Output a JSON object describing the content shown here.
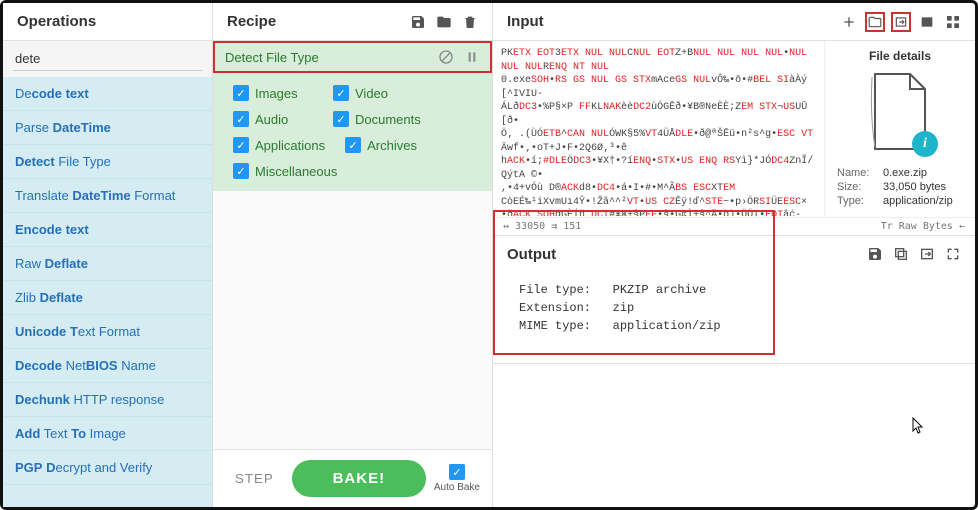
{
  "operations": {
    "title": "Operations",
    "search_value": "dete",
    "items": [
      "De<b>code</b> <b>text</b>",
      "Parse <b>DateTime</b>",
      "<b>Detect</b> File Type",
      "Translate <b>DateTime</b> Format",
      "<b>Encode</b> <b>text</b>",
      "Raw <b>Deflate</b>",
      "Zlib <b>Deflate</b>",
      "<b>Unicode</b> <b>T</b>ext Format",
      "<b>Decode</b> Net<b>BIOS</b> Name",
      "<b>Dechunk</b> HTTP response",
      "<b>Add</b> Text <b>To</b> Image",
      "<b>PGP</b> <b>D</b>ecrypt and Verify"
    ]
  },
  "recipe": {
    "title": "Recipe",
    "op": {
      "title": "Detect File Type",
      "checks": [
        "Images",
        "Video",
        "Audio",
        "Documents",
        "Applications",
        "Archives",
        "Miscellaneous"
      ]
    },
    "step_label": "STEP",
    "bake_label": "BAKE!",
    "autobake_label": "Auto Bake"
  },
  "input": {
    "title": "Input",
    "hexdump": "PK<span class='red'>ETX EOT</span>3<span class='red'>ETX NUL NUL</span>C<span class='red'>NUL EOT</span>Z+B<span class='red'>NUL NUL NUL NUL</span>•<span class='red'>NUL NUL NUL</span>R<span class='red'>ENQ NT NUL</span>\\n0.exe<span class='red'>SOH</span>•<span class='red'>RS GS NUL GS STX</span>mAce<span class='red'>GS NUL</span>vÔ‰•ō•#<span class='red'>BEL SI</span>àÀý[^IVIU-\\nÁLð<span class='red'>DC3</span>•%P§×P <span class='red'>FF</span>KL<span class='red'>NAK</span>èè<span class='red'>DC2</span>ùÓGĒð•¥B®NeÈÈ;Z<span class='red'>EM STX</span>¬<span class='red'>US</span>UŪ[ð•\\nÖ‚ .(ÙÓ<span class='red'>ETB</span>^<span class='red'>CAN NUL</span>ÓWK§5%<span class='red'>VT</span>4ÜÅ<span class='red'>DLE</span>•ð@ªŠĒü•n²s^g•<span class='red'>ESC VT</span>\\nÄwf•‚•oT+J•F•2Q6Ø‚³•ê\\nh<span class='red'>ACK</span>•í;<span class='red'>#DLE</span>Ö<span class='red'>DC3</span>•¥X†•?í<span class='red'>ENQ</span>•<span class='red'>STX</span>•<span class='red'>US ENQ RS</span>Yì}*JÓ<span class='red'>DC4</span>ZnĨ/QýtA ©•\\n,•4+vÓù    D®<span class='red'>ACK</span>d8•<span class='red'>DC4</span>•á•I•#•M^Ã<span class='red'>BS ESC</span>XT<span class='red'>EM</span>\\nCòEÉ‰¹iXvmUı4Ŷ•!Žâ^^²<span class='red'>VT</span>•<span class='red'>US CZ</span>Êÿ!ď^<span class='red'>STE</span>~•p›ÖR<span class='red'>SI</span>ÜE<span class='red'>ESC</span>×\\n•ð<span class='red'>ACK SOH</span>ģGÈÍň‚<span class='red'>DCI</span>#¥Ж+§P<span class='red'>FF</span>•§•G¢Ì+§^Ä•ò)•ÖÖI•<span class='red'>EOT</span>âċ-\\nÓñ<span class='red'>SO</span>• <span class='red'>ETB</span>|µÐ•þ•¬Í•<span class='red'>DCI</span>••[<span class='red'>ETB STX FS</span>•<span class='red'>US DLE</span>Ö‡Ó4ØP4=ø<span class='red'>SO</span>•<span class='red'>RS</span>•\\nƠF=mŴ^t•H<b>†t</b>ø<span class='red'>ENQ CR</span>•Ö¿¹<q<span class='red'>NUL</span>•þð•ð<span class='red'>NUL</span>Ö•ðī•m<span class='red'>ETB</span>•<span class='red'>STX</span>•<span class='red'>ETB</span>ð<b>B</b>ˆB•",
    "status_left": "↔ 33050 ⇉ 151",
    "status_right": "Tr Raw Bytes  ←",
    "file_details": {
      "title": "File details",
      "name_label": "Name:",
      "name_value": "0.exe.zip",
      "size_label": "Size:",
      "size_value": "33,050 bytes",
      "type_label": "Type:",
      "type_value": "application/zip"
    }
  },
  "output": {
    "title": "Output",
    "body": "File type:   PKZIP archive\nExtension:   zip\nMIME type:   application/zip"
  }
}
